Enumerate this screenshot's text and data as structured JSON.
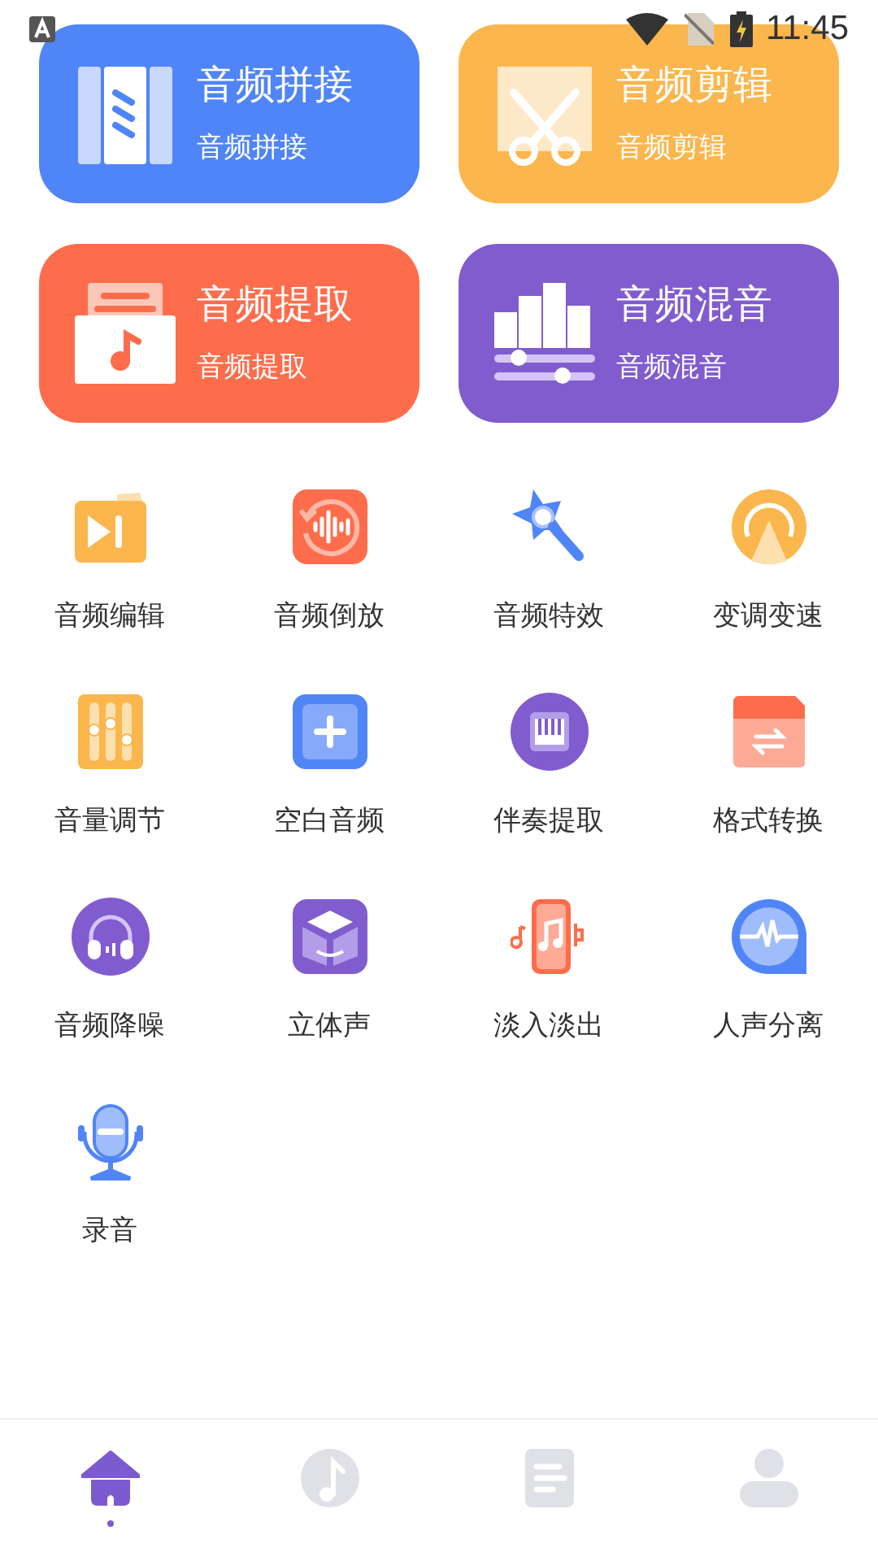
{
  "status_bar": {
    "time": "11:45"
  },
  "feature_cards": [
    {
      "title": "音频拼接",
      "subtitle": "音频拼接",
      "color": "#5085f7",
      "kind": "splice"
    },
    {
      "title": "音频剪辑",
      "subtitle": "音频剪辑",
      "color": "#fbb64d",
      "kind": "cut"
    },
    {
      "title": "音频提取",
      "subtitle": "音频提取",
      "color": "#fd6d4c",
      "kind": "extract"
    },
    {
      "title": "音频混音",
      "subtitle": "音频混音",
      "color": "#805ccf",
      "kind": "mix"
    }
  ],
  "tools": [
    {
      "label": "音频编辑",
      "kind": "play"
    },
    {
      "label": "音频倒放",
      "kind": "reverse"
    },
    {
      "label": "音频特效",
      "kind": "wand"
    },
    {
      "label": "变调变速",
      "kind": "speed"
    },
    {
      "label": "音量调节",
      "kind": "sliders"
    },
    {
      "label": "空白音频",
      "kind": "plus"
    },
    {
      "label": "伴奏提取",
      "kind": "piano"
    },
    {
      "label": "格式转换",
      "kind": "convert"
    },
    {
      "label": "音频降噪",
      "kind": "headphones"
    },
    {
      "label": "立体声",
      "kind": "cube"
    },
    {
      "label": "淡入淡出",
      "kind": "phone"
    },
    {
      "label": "人声分离",
      "kind": "bubble"
    },
    {
      "label": "录音",
      "kind": "mic"
    }
  ],
  "bottom_nav": [
    {
      "kind": "home",
      "selected": true
    },
    {
      "kind": "music",
      "selected": false
    },
    {
      "kind": "document",
      "selected": false
    },
    {
      "kind": "profile",
      "selected": false
    }
  ]
}
